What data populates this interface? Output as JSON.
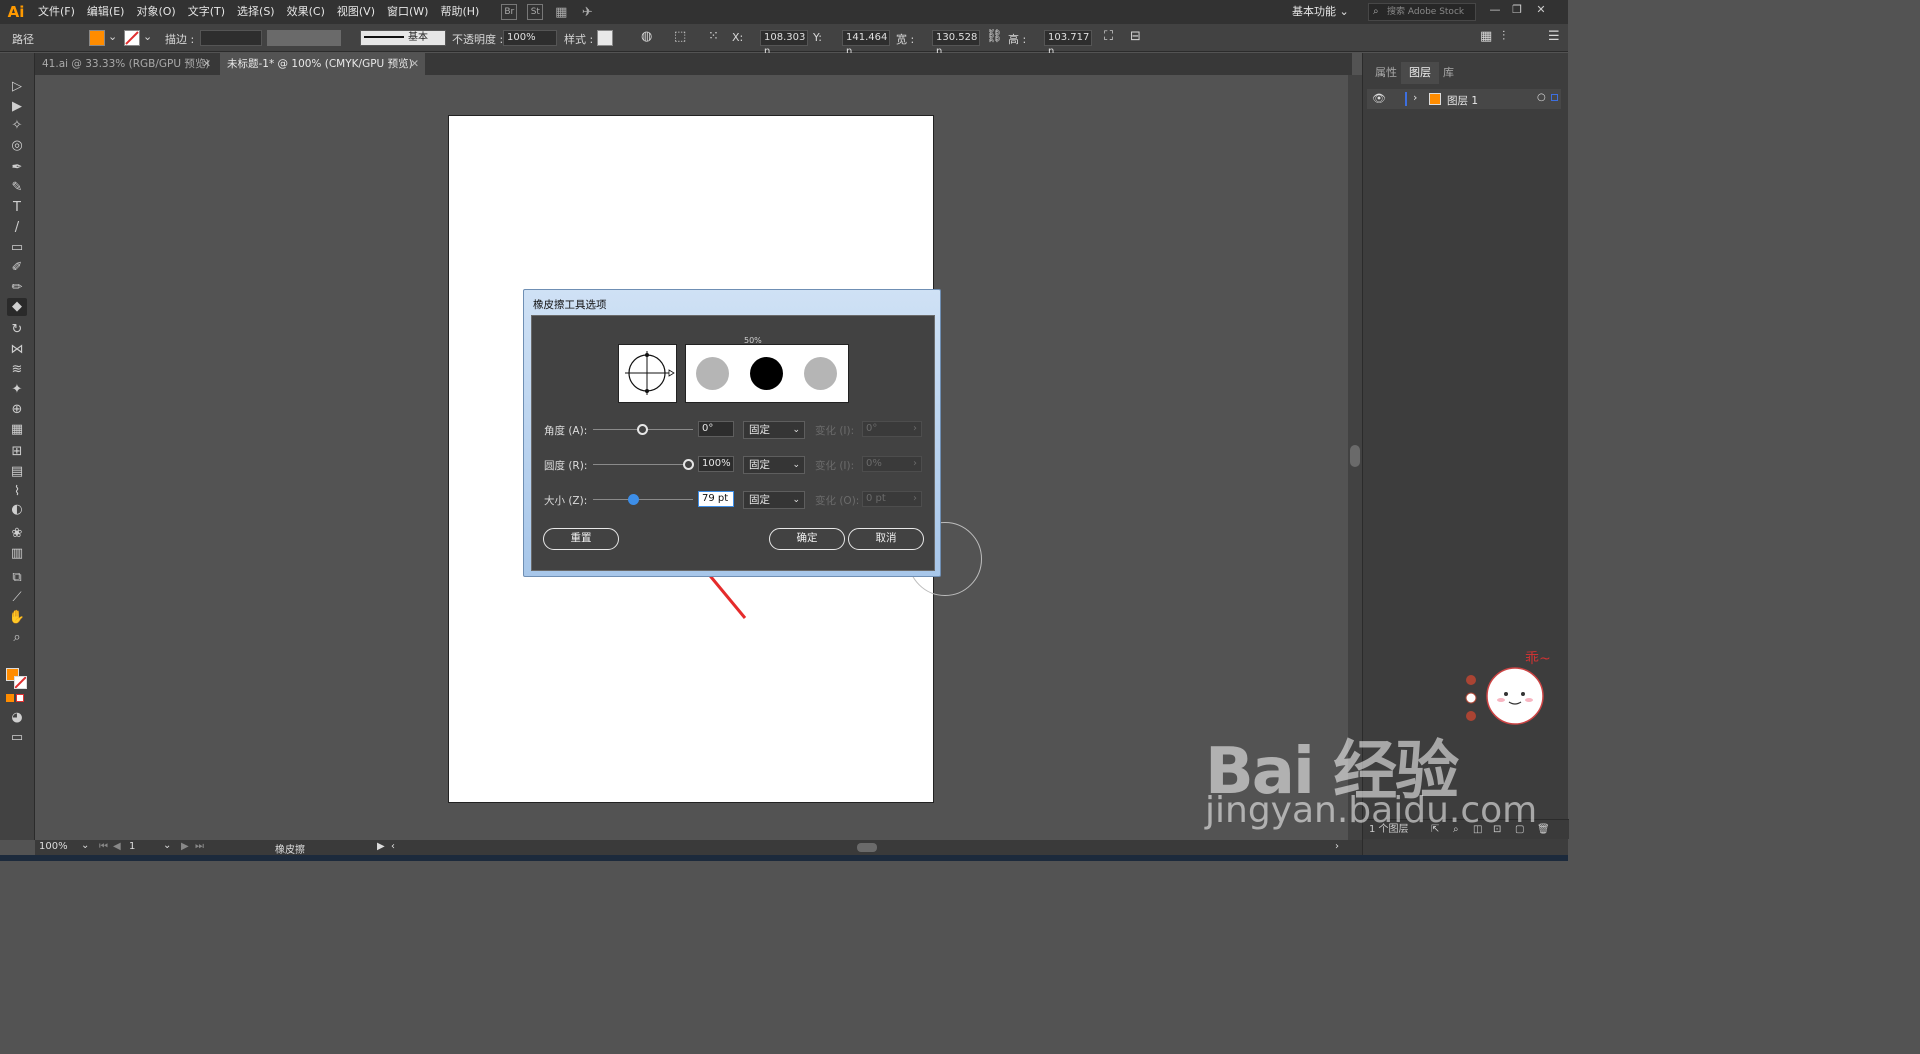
{
  "app": {
    "logo": "Ai",
    "menus": [
      "文件(F)",
      "编辑(E)",
      "对象(O)",
      "文字(T)",
      "选择(S)",
      "效果(C)",
      "视图(V)",
      "窗口(W)",
      "帮助(H)"
    ],
    "menubar_icons": [
      "Br",
      "St"
    ],
    "workspace": "基本功能",
    "stock_search_placeholder": "搜索 Adobe Stock",
    "window_buttons": [
      "—",
      "❐",
      "✕"
    ]
  },
  "control_bar": {
    "selection_label": "路径",
    "fill_color": "#ff8c00",
    "stroke_label": "描边 :",
    "stroke_style": "基本",
    "opacity_label": "不透明度 :",
    "opacity_value": "100%",
    "style_label": "样式 :",
    "x_label": "X:",
    "x_value": "108.303 n",
    "y_label": "Y:",
    "y_value": "141.464 n",
    "w_label": "宽 :",
    "w_value": "130.528 n",
    "h_label": "高 :",
    "h_value": "103.717 n"
  },
  "tabs": [
    {
      "label": "41.ai @ 33.33% (RGB/GPU 预览)",
      "close": "✕",
      "active": false
    },
    {
      "label": "未标题-1* @ 100% (CMYK/GPU 预览)",
      "close": "✕",
      "active": true
    }
  ],
  "tools": [
    {
      "name": "selection-tool-icon",
      "glyph": "▷"
    },
    {
      "name": "direct-selection-tool-icon",
      "glyph": "▶"
    },
    {
      "name": "magic-wand-tool-icon",
      "glyph": "✧"
    },
    {
      "name": "lasso-tool-icon",
      "glyph": "◎"
    },
    {
      "name": "pen-tool-icon",
      "glyph": "✒"
    },
    {
      "name": "curvature-tool-icon",
      "glyph": "✎"
    },
    {
      "name": "type-tool-icon",
      "glyph": "T"
    },
    {
      "name": "line-tool-icon",
      "glyph": "/"
    },
    {
      "name": "rectangle-tool-icon",
      "glyph": "▭"
    },
    {
      "name": "paintbrush-tool-icon",
      "glyph": "✐"
    },
    {
      "name": "shaper-tool-icon",
      "glyph": "✏"
    },
    {
      "name": "eraser-tool-icon",
      "glyph": "◆"
    },
    {
      "name": "rotate-tool-icon",
      "glyph": "↻"
    },
    {
      "name": "width-tool-icon",
      "glyph": "⋈"
    },
    {
      "name": "warp-tool-icon",
      "glyph": "≋"
    },
    {
      "name": "puppet-warp-tool-icon",
      "glyph": "✦"
    },
    {
      "name": "shape-builder-tool-icon",
      "glyph": "⊕"
    },
    {
      "name": "perspective-grid-tool-icon",
      "glyph": "▦"
    },
    {
      "name": "mesh-tool-icon",
      "glyph": "⊞"
    },
    {
      "name": "gradient-tool-icon",
      "glyph": "▤"
    },
    {
      "name": "eyedropper-tool-icon",
      "glyph": "⌇"
    },
    {
      "name": "blend-tool-icon",
      "glyph": "◐"
    },
    {
      "name": "symbol-sprayer-tool-icon",
      "glyph": "❀"
    },
    {
      "name": "column-graph-tool-icon",
      "glyph": "▥"
    },
    {
      "name": "artboard-tool-icon",
      "glyph": "⧉"
    },
    {
      "name": "slice-tool-icon",
      "glyph": "⟋"
    },
    {
      "name": "hand-tool-icon",
      "glyph": "✋"
    },
    {
      "name": "zoom-tool-icon",
      "glyph": "⌕"
    }
  ],
  "colors": {
    "fill": "#ff8c00",
    "stroke_none": "#e03030",
    "accent": "#3d8ee8",
    "dialog_title_bar": "#bcd5f0"
  },
  "panel": {
    "tabs": [
      "属性",
      "图层",
      "库"
    ],
    "layer_name": "图层 1",
    "layer_color": "#ff8c00",
    "footer": "1 个图层"
  },
  "status": {
    "zoom": "100%",
    "artboard": "1",
    "tool": "橡皮擦"
  },
  "dialog": {
    "title": "橡皮擦工具选项",
    "preview_percent": "50%",
    "rows": [
      {
        "label": "角度 (A):",
        "value": "0°",
        "mode": "固定",
        "variation_label": "变化 (I):",
        "variation": "0°"
      },
      {
        "label": "圆度 (R):",
        "value": "100%",
        "mode": "固定",
        "variation_label": "变化 (I):",
        "variation": "0%"
      },
      {
        "label": "大小 (Z):",
        "value": "79 pt",
        "mode": "固定",
        "variation_label": "变化 (O):",
        "variation": "0 pt"
      }
    ],
    "reset_label": "重置",
    "ok_label": "确定",
    "cancel_label": "取消"
  },
  "watermark": {
    "brand": "Bai  经验",
    "url": "jingyan.baidu.com",
    "mascot_text": "乖~"
  }
}
